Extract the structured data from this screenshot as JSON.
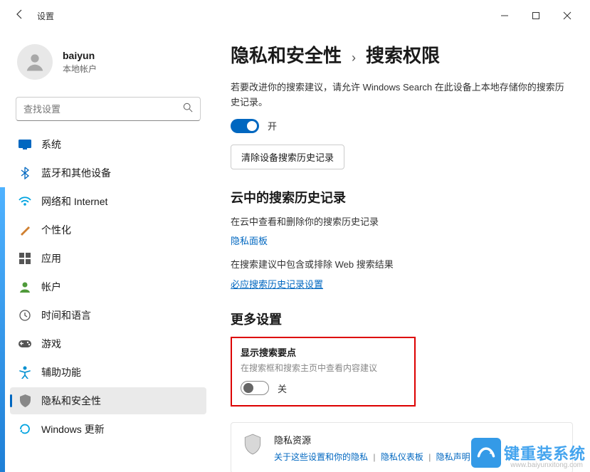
{
  "titlebar": {
    "title": "设置"
  },
  "account": {
    "name": "baiyun",
    "sub": "本地帐户"
  },
  "search": {
    "placeholder": "查找设置"
  },
  "nav": [
    {
      "key": "system",
      "label": "系统",
      "icon": "system",
      "color": "#0067c0"
    },
    {
      "key": "bluetooth",
      "label": "蓝牙和其他设备",
      "icon": "bluetooth",
      "color": "#0067c0"
    },
    {
      "key": "network",
      "label": "网络和 Internet",
      "icon": "wifi",
      "color": "#00a3e0"
    },
    {
      "key": "personalization",
      "label": "个性化",
      "icon": "brush",
      "color": "#d08030"
    },
    {
      "key": "apps",
      "label": "应用",
      "icon": "apps",
      "color": "#555"
    },
    {
      "key": "accounts",
      "label": "帐户",
      "icon": "person",
      "color": "#4f9a3a"
    },
    {
      "key": "time",
      "label": "时间和语言",
      "icon": "clock",
      "color": "#555"
    },
    {
      "key": "gaming",
      "label": "游戏",
      "icon": "game",
      "color": "#555"
    },
    {
      "key": "accessibility",
      "label": "辅助功能",
      "icon": "access",
      "color": "#0090d0"
    },
    {
      "key": "privacy",
      "label": "隐私和安全性",
      "icon": "shield",
      "color": "#888",
      "selected": true
    },
    {
      "key": "update",
      "label": "Windows 更新",
      "icon": "update",
      "color": "#00a3e0"
    }
  ],
  "crumbs": {
    "c1": "隐私和安全性",
    "c2": "搜索权限"
  },
  "sec_local": {
    "desc": "若要改进你的搜索建议，请允许 Windows Search 在此设备上本地存储你的搜索历史记录。",
    "toggle_label": "开",
    "clear_btn": "清除设备搜索历史记录"
  },
  "sec_cloud": {
    "heading": "云中的搜索历史记录",
    "line1": "在云中查看和删除你的搜索历史记录",
    "link1": "隐私面板",
    "line2": "在搜索建议中包含或排除 Web 搜索结果",
    "link2": "必应搜索历史记录设置"
  },
  "sec_more": {
    "heading": "更多设置",
    "box_title": "显示搜索要点",
    "box_desc": "在搜索框和搜索主页中查看内容建议",
    "box_toggle_label": "关"
  },
  "card": {
    "title": "隐私资源",
    "link1": "关于这些设置和你的隐私",
    "link2": "隐私仪表板",
    "link3": "隐私声明"
  },
  "watermark": {
    "text": "键重装系统",
    "url": "www.baiyunxitong.com"
  }
}
